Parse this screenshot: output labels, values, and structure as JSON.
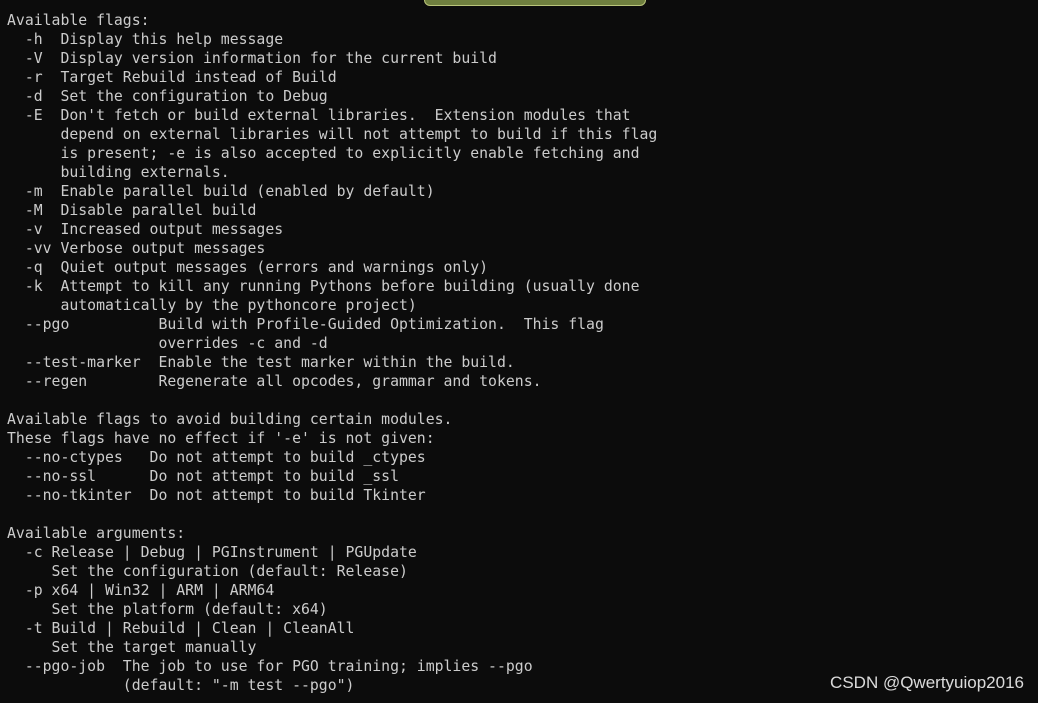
{
  "terminal": {
    "lines": [
      "Available flags:",
      "  -h  Display this help message",
      "  -V  Display version information for the current build",
      "  -r  Target Rebuild instead of Build",
      "  -d  Set the configuration to Debug",
      "  -E  Don't fetch or build external libraries.  Extension modules that",
      "      depend on external libraries will not attempt to build if this flag",
      "      is present; -e is also accepted to explicitly enable fetching and",
      "      building externals.",
      "  -m  Enable parallel build (enabled by default)",
      "  -M  Disable parallel build",
      "  -v  Increased output messages",
      "  -vv Verbose output messages",
      "  -q  Quiet output messages (errors and warnings only)",
      "  -k  Attempt to kill any running Pythons before building (usually done",
      "      automatically by the pythoncore project)",
      "  --pgo          Build with Profile-Guided Optimization.  This flag",
      "                 overrides -c and -d",
      "  --test-marker  Enable the test marker within the build.",
      "  --regen        Regenerate all opcodes, grammar and tokens.",
      "",
      "Available flags to avoid building certain modules.",
      "These flags have no effect if '-e' is not given:",
      "  --no-ctypes   Do not attempt to build _ctypes",
      "  --no-ssl      Do not attempt to build _ssl",
      "  --no-tkinter  Do not attempt to build Tkinter",
      "",
      "Available arguments:",
      "  -c Release | Debug | PGInstrument | PGUpdate",
      "     Set the configuration (default: Release)",
      "  -p x64 | Win32 | ARM | ARM64",
      "     Set the platform (default: x64)",
      "  -t Build | Rebuild | Clean | CleanAll",
      "     Set the target manually",
      "  --pgo-job  The job to use for PGO training; implies --pgo",
      "             (default: \"-m test --pgo\")"
    ]
  },
  "watermark": {
    "text": "CSDN @Qwertyuiop2016"
  }
}
